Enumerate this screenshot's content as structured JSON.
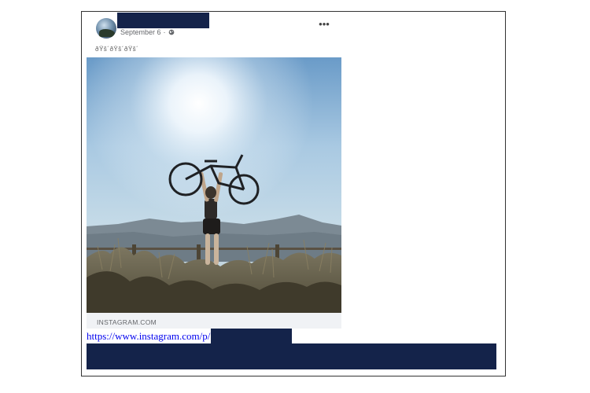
{
  "post": {
    "date": "September 6",
    "separator": "·",
    "visibility_icon": "globe-icon",
    "more_icon": "more-options-icon",
    "more_label": "•••",
    "text": "ðŸš´ðŸš´ðŸš´",
    "image_description": "",
    "link_preview": {
      "domain": "INSTAGRAM.COM"
    }
  },
  "link": {
    "url_text": "https://www.instagram.com/p/"
  },
  "colors": {
    "redaction": "#14234a",
    "link": "#0000ee",
    "meta_text": "#65676b",
    "preview_background": "#f0f2f5"
  }
}
